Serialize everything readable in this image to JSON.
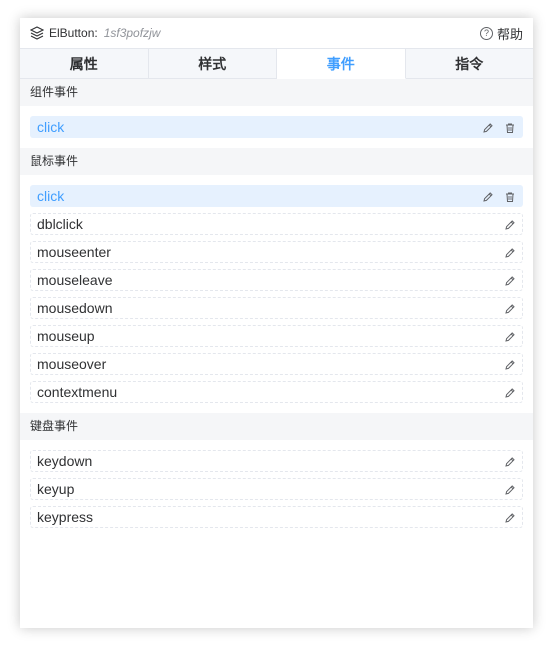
{
  "header": {
    "component_label": "ElButton:",
    "component_id": "1sf3pofzjw",
    "help_label": "帮助"
  },
  "tabs": [
    {
      "label": "属性",
      "active": false
    },
    {
      "label": "样式",
      "active": false
    },
    {
      "label": "事件",
      "active": true
    },
    {
      "label": "指令",
      "active": false
    }
  ],
  "sections": {
    "component_events": {
      "title": "组件事件",
      "items": [
        {
          "name": "click",
          "bound": true
        }
      ]
    },
    "mouse_events": {
      "title": "鼠标事件",
      "items": [
        {
          "name": "click",
          "bound": true
        },
        {
          "name": "dblclick",
          "bound": false
        },
        {
          "name": "mouseenter",
          "bound": false
        },
        {
          "name": "mouseleave",
          "bound": false
        },
        {
          "name": "mousedown",
          "bound": false
        },
        {
          "name": "mouseup",
          "bound": false
        },
        {
          "name": "mouseover",
          "bound": false
        },
        {
          "name": "contextmenu",
          "bound": false
        }
      ]
    },
    "keyboard_events": {
      "title": "键盘事件",
      "items": [
        {
          "name": "keydown",
          "bound": false
        },
        {
          "name": "keyup",
          "bound": false
        },
        {
          "name": "keypress",
          "bound": false
        }
      ]
    }
  },
  "icons": {
    "layers": "layers-icon",
    "help": "help-icon",
    "edit": "pencil-icon",
    "delete": "trash-icon"
  },
  "colors": {
    "accent": "#409eff",
    "bound_row_bg": "#e6f1fe",
    "section_bg": "#f5f6f8"
  }
}
